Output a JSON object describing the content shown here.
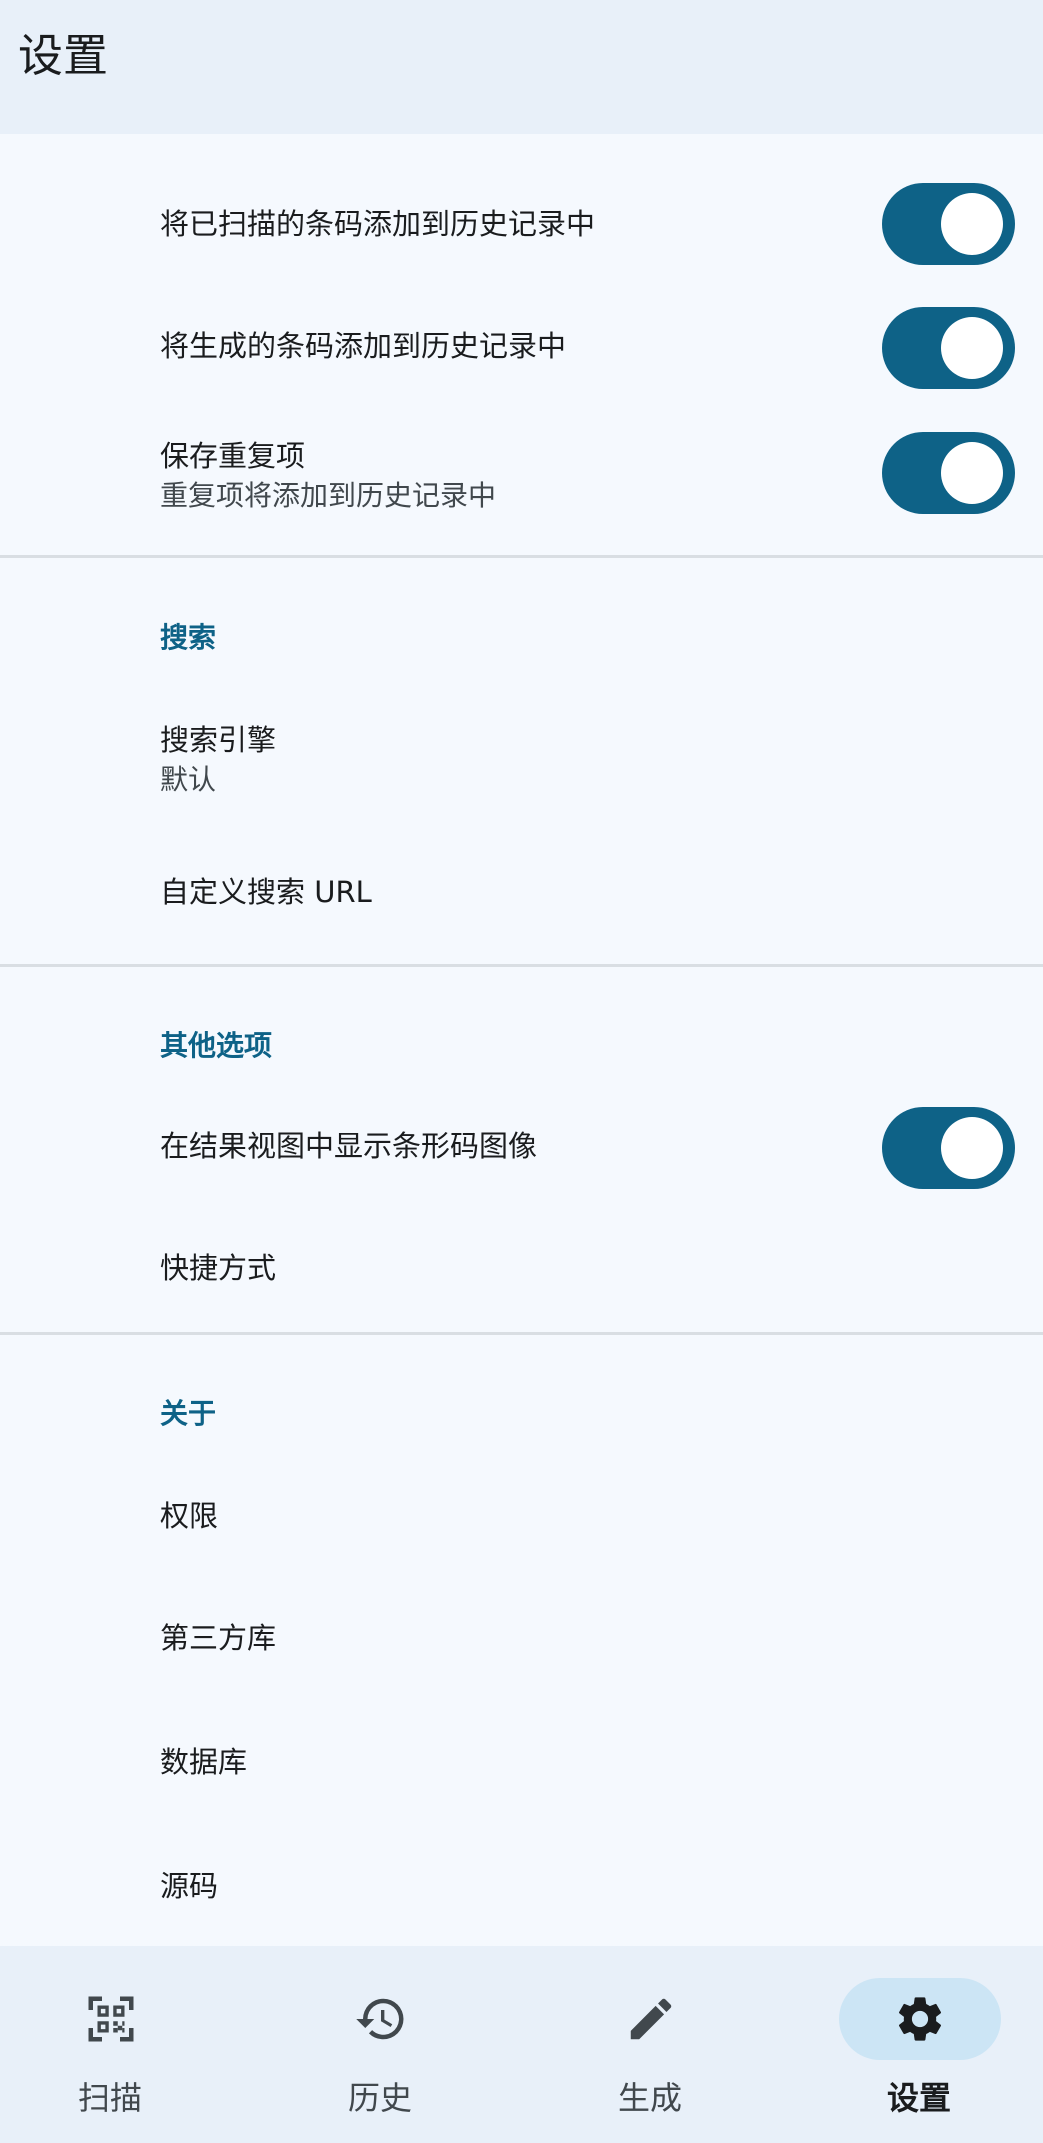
{
  "app_bar": {
    "title": "设置"
  },
  "history_section": {
    "items": [
      {
        "title": "将已扫描的条码添加到历史记录中",
        "toggle": true
      },
      {
        "title": "将生成的条码添加到历史记录中",
        "toggle": true
      },
      {
        "title": "保存重复项",
        "subtitle": "重复项将添加到历史记录中",
        "toggle": true
      }
    ]
  },
  "search_section": {
    "header": "搜索",
    "items": [
      {
        "title": "搜索引擎",
        "subtitle": "默认"
      },
      {
        "title": "自定义搜索 URL"
      }
    ]
  },
  "other_section": {
    "header": "其他选项",
    "items": [
      {
        "title": "在结果视图中显示条形码图像",
        "toggle": true
      },
      {
        "title": "快捷方式"
      }
    ]
  },
  "about_section": {
    "header": "关于",
    "items": [
      {
        "title": "权限"
      },
      {
        "title": "第三方库"
      },
      {
        "title": "数据库"
      },
      {
        "title": "源码"
      }
    ]
  },
  "bottom_nav": {
    "items": [
      {
        "label": "扫描",
        "icon": "qr-code-scanner-icon",
        "active": false
      },
      {
        "label": "历史",
        "icon": "history-icon",
        "active": false
      },
      {
        "label": "生成",
        "icon": "pencil-icon",
        "active": false
      },
      {
        "label": "设置",
        "icon": "gear-icon",
        "active": true
      }
    ]
  },
  "colors": {
    "accent": "#0e6287",
    "background": "#f5f9fe",
    "bar": "#e8f0f9",
    "active_pill": "#cce5f5"
  }
}
